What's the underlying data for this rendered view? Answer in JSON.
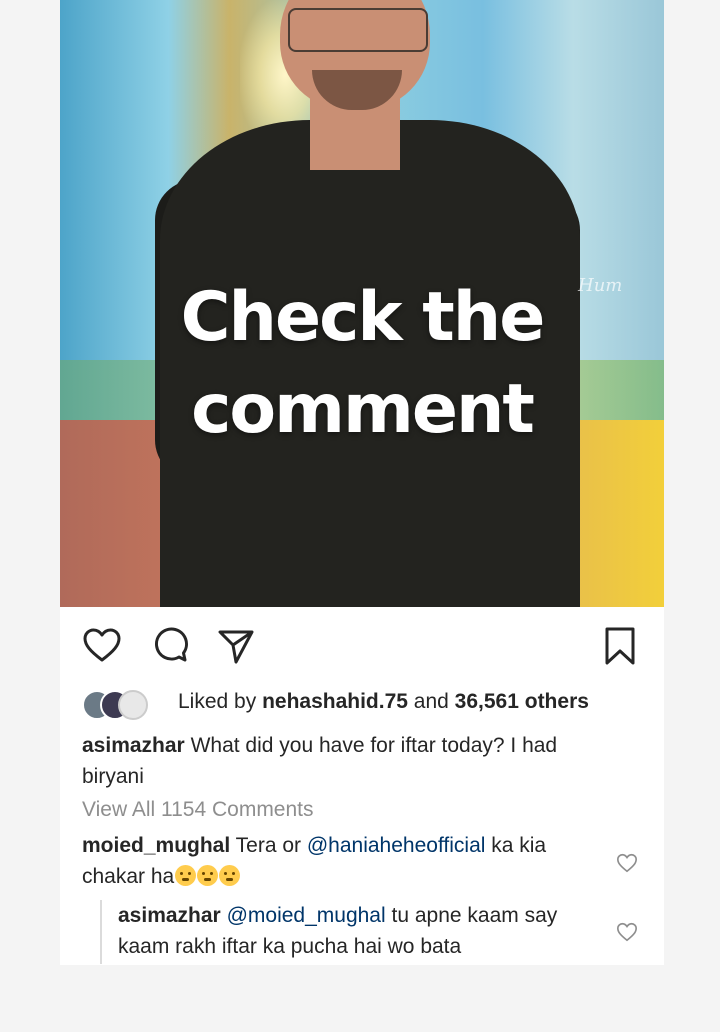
{
  "post": {
    "overlay_line1": "Check the",
    "overlay_line2": "comment",
    "watermark": "Hum"
  },
  "actions": {
    "icons": [
      "heart-icon",
      "comment-icon",
      "share-icon",
      "bookmark-icon"
    ]
  },
  "likes": {
    "prefix": "Liked by ",
    "user": "nehashahid.75",
    "middle": " and ",
    "count": "36,561 others"
  },
  "caption": {
    "username": "asimazhar",
    "text": " What did you have for iftar today? I had biryani"
  },
  "view_all": "View All 1154 Comments",
  "comment": {
    "username": "moied_mughal",
    "text_before": " Tera or ",
    "mention": "@haniaheheofficial",
    "text_after": " ka kia chakar ha"
  },
  "reply": {
    "username": "asimazhar",
    "mention": "@moied_mughal",
    "text": " tu apne kaam say kaam rakh iftar ka pucha hai wo bata"
  },
  "colors": {
    "text": "#262626",
    "muted": "#8e8e8e",
    "mention": "#003569",
    "background": "#f4f4f4"
  }
}
